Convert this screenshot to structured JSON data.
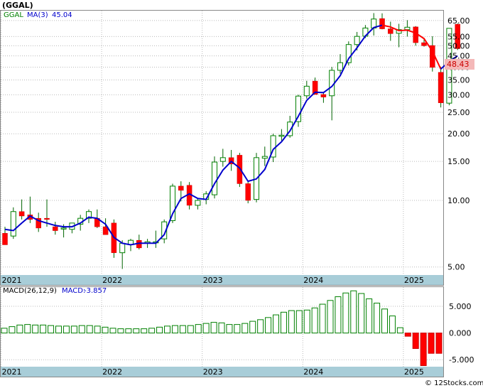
{
  "title": "(GGAL)",
  "legend": {
    "symbol": "GGAL",
    "ma_label": "MA(3)",
    "ma_value": "45.04"
  },
  "price_tag": "48.43",
  "macd_legend": {
    "name": "MACD(26,12,9)",
    "label": "MACD:",
    "value": "-3.857"
  },
  "watermark": "© 12Stocks.com",
  "colors": {
    "up": "#008000",
    "down": "#ff0000",
    "ma": "#0000cc",
    "ma_down": "#ff0000",
    "axis_band": "#a8cdd8",
    "tag_bg": "#f4b8b8",
    "tag_text": "#cc0000"
  },
  "years": [
    "2021",
    "2022",
    "2023",
    "2024",
    "2025"
  ],
  "price_ticks": [
    "65.00",
    "55.00",
    "50.00",
    "45.00",
    "40.00",
    "35.00",
    "30.00",
    "25.00",
    "20.00",
    "15.00",
    "10.00",
    "5.00"
  ],
  "macd_ticks": [
    "5.000",
    "0.000",
    "-5.000"
  ],
  "chart_data": [
    {
      "type": "candlestick",
      "scale": "log",
      "ylim": [
        4.6,
        72
      ],
      "x_start": "2021-01",
      "x_step": "month",
      "ohlc": [
        [
          7.1,
          7.6,
          6.3,
          6.3
        ],
        [
          6.9,
          9.3,
          6.7,
          8.9
        ],
        [
          8.9,
          10.1,
          8.2,
          8.5
        ],
        [
          8.6,
          10.4,
          7.9,
          8.2
        ],
        [
          8.3,
          8.8,
          7.2,
          7.5
        ],
        [
          8.3,
          10.1,
          7.6,
          8.2
        ],
        [
          7.6,
          8.0,
          7.0,
          7.3
        ],
        [
          7.5,
          7.8,
          6.8,
          7.5
        ],
        [
          7.4,
          7.9,
          7.1,
          7.9
        ],
        [
          7.8,
          8.6,
          7.3,
          8.3
        ],
        [
          8.3,
          9.1,
          7.9,
          8.9
        ],
        [
          8.3,
          9.1,
          7.5,
          7.6
        ],
        [
          7.6,
          8.3,
          7.0,
          7.0
        ],
        [
          7.9,
          8.2,
          5.5,
          5.8
        ],
        [
          5.8,
          6.6,
          4.9,
          6.4
        ],
        [
          6.3,
          6.7,
          5.9,
          6.6
        ],
        [
          6.6,
          7.0,
          6.0,
          6.1
        ],
        [
          6.4,
          6.7,
          6.1,
          6.5
        ],
        [
          6.5,
          7.3,
          6.1,
          6.5
        ],
        [
          6.7,
          8.2,
          6.4,
          8.0
        ],
        [
          8.1,
          11.9,
          7.9,
          11.6
        ],
        [
          11.6,
          12.2,
          9.9,
          11.1
        ],
        [
          11.7,
          12.1,
          9.1,
          9.5
        ],
        [
          9.5,
          10.2,
          9.1,
          10.0
        ],
        [
          10.1,
          11.0,
          9.6,
          10.7
        ],
        [
          10.6,
          15.8,
          10.2,
          14.9
        ],
        [
          15.0,
          17.1,
          14.2,
          15.6
        ],
        [
          15.6,
          16.9,
          13.6,
          14.6
        ],
        [
          16.0,
          16.4,
          11.5,
          11.9
        ],
        [
          11.9,
          12.3,
          9.7,
          10.0
        ],
        [
          10.1,
          16.4,
          9.8,
          15.6
        ],
        [
          15.5,
          17.5,
          14.3,
          15.8
        ],
        [
          15.7,
          20.0,
          14.9,
          19.6
        ],
        [
          19.6,
          21.0,
          18.6,
          19.7
        ],
        [
          19.6,
          24.1,
          19.2,
          22.6
        ],
        [
          22.7,
          30.0,
          21.5,
          29.6
        ],
        [
          29.7,
          34.7,
          28.8,
          32.8
        ],
        [
          34.6,
          35.9,
          30.1,
          30.1
        ],
        [
          30.1,
          30.6,
          27.6,
          29.3
        ],
        [
          29.7,
          40.1,
          23.0,
          38.7
        ],
        [
          38.7,
          45.8,
          37.4,
          41.9
        ],
        [
          41.9,
          52.3,
          40.7,
          50.6
        ],
        [
          50.6,
          57.7,
          47.6,
          55.1
        ],
        [
          55.2,
          62.0,
          54.1,
          60.1
        ],
        [
          60.1,
          70.2,
          55.6,
          66.0
        ],
        [
          66.3,
          70.0,
          59.3,
          59.6
        ],
        [
          59.6,
          64.2,
          52.6,
          56.7
        ],
        [
          56.9,
          62.8,
          49.2,
          59.1
        ],
        [
          59.1,
          65.2,
          55.0,
          60.6
        ],
        [
          60.8,
          61.3,
          50.0,
          51.6
        ],
        [
          51.6,
          54.3,
          49.5,
          50.0
        ],
        [
          50.1,
          55.2,
          38.2,
          39.9
        ],
        [
          37.9,
          40.2,
          26.3,
          27.6
        ],
        [
          27.5,
          60.0,
          26.9,
          59.9
        ],
        [
          62.5,
          63.0,
          47.8,
          48.5
        ]
      ],
      "ma3": [
        7.4,
        7.3,
        7.9,
        8.5,
        8.1,
        7.9,
        7.7,
        7.6,
        7.6,
        7.9,
        8.4,
        8.3,
        7.8,
        6.8,
        6.4,
        6.3,
        6.4,
        6.4,
        6.4,
        7.0,
        8.7,
        10.2,
        10.7,
        10.2,
        10.1,
        11.9,
        13.7,
        15.0,
        14.0,
        12.2,
        12.5,
        13.8,
        17.0,
        18.4,
        20.6,
        24.0,
        28.3,
        30.8,
        30.7,
        32.7,
        36.6,
        43.7,
        48.9,
        55.3,
        60.4,
        61.9,
        60.8,
        58.5,
        58.8,
        57.1,
        53.8,
        47.2,
        39.2,
        42.5,
        45.0
      ],
      "ma3_down_from": 45,
      "ma3_down_to": 52
    },
    {
      "type": "bar",
      "name": "MACD",
      "ylim": [
        -6.3,
        8.6
      ],
      "values": [
        0.9,
        1.2,
        1.5,
        1.6,
        1.5,
        1.5,
        1.4,
        1.3,
        1.3,
        1.3,
        1.4,
        1.4,
        1.3,
        1.1,
        0.9,
        0.8,
        0.8,
        0.8,
        0.8,
        0.9,
        1.1,
        1.3,
        1.4,
        1.4,
        1.4,
        1.6,
        1.8,
        2.0,
        1.9,
        1.6,
        1.6,
        1.8,
        2.2,
        2.5,
        2.9,
        3.4,
        3.9,
        4.2,
        4.2,
        4.3,
        4.7,
        5.4,
        6.1,
        6.8,
        7.5,
        7.9,
        7.4,
        6.4,
        5.6,
        4.5,
        3.2,
        1.0,
        -0.6,
        -2.9,
        -6.1,
        -3.8,
        -3.8
      ]
    }
  ]
}
